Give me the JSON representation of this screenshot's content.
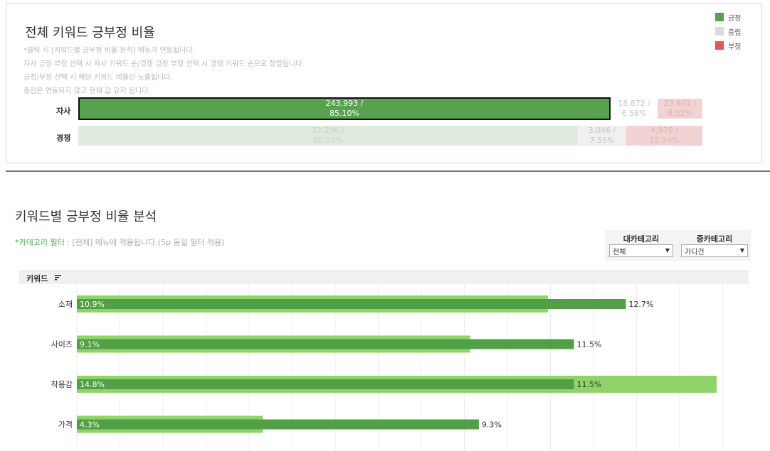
{
  "top_section": {
    "title": "전체 키워드 긍부정 비율",
    "notes": [
      "*클릭 시 [키워드별 긍부정 비율 분석] 메뉴가 연동됩니다.",
      "자사 긍정 부정 선택 시 자사 키워드 순/경쟁 긍정 부정 선택 시 경쟁 키워드 순으로 정렬됩니다.",
      "긍정/부정 선택 시 해당 키워드 비율만 노출됩니다.",
      "중립은 연동되지 않고 현재 값 유지 됩니다."
    ],
    "legend": [
      {
        "label": "긍정",
        "color": "#58a14e"
      },
      {
        "label": "중립",
        "color": "#dadada"
      },
      {
        "label": "부정",
        "color": "#e15759"
      }
    ],
    "rows": [
      {
        "label": "자사",
        "segments": [
          {
            "sentiment": "긍정",
            "count": "243,993 /",
            "pct": "85.10%",
            "share": 0.851
          },
          {
            "sentiment": "중립",
            "count": "18,872 /",
            "pct": "6.58%",
            "share": 0.0658
          },
          {
            "sentiment": "부정",
            "count": "23,841 /",
            "pct": "8.32%",
            "share": 0.0832
          }
        ]
      },
      {
        "label": "경쟁",
        "segments": [
          {
            "sentiment": "긍정",
            "count": "32,296 /",
            "pct": "80.10%",
            "share": 0.801
          },
          {
            "sentiment": "중립",
            "count": "3,046 /",
            "pct": "7.55%",
            "share": 0.0755
          },
          {
            "sentiment": "부정",
            "count": "4,976 /",
            "pct": "12.34%",
            "share": 0.1234
          }
        ]
      }
    ]
  },
  "keyword_section": {
    "title": "키워드별 긍부정 비율 분석",
    "filter_note_label": "*카테고리 필터",
    "filter_note_text": " : [전체] 메뉴에 적용됩니다.(5p 동일 필터 적용)",
    "filters": [
      {
        "title": "대카테고리",
        "value": "전체"
      },
      {
        "title": "중카테고리",
        "value": "가디건"
      }
    ],
    "column_header": "키워드"
  },
  "chart_data": {
    "type": "bar",
    "categories": [
      "소재",
      "사이즈",
      "착용감",
      "가격"
    ],
    "series": [
      {
        "values": [
          10.9,
          9.1,
          14.8,
          4.3
        ],
        "labels": [
          "10.9%",
          "9.1%",
          "14.8%",
          "4.3%"
        ],
        "color": "#8fd36a"
      },
      {
        "values": [
          12.7,
          11.5,
          11.5,
          9.3
        ],
        "labels": [
          "12.7%",
          "11.5%",
          "11.5%",
          "9.3%"
        ],
        "color": "#52a045"
      }
    ],
    "xlim": [
      0,
      14.8
    ],
    "grid": true
  }
}
